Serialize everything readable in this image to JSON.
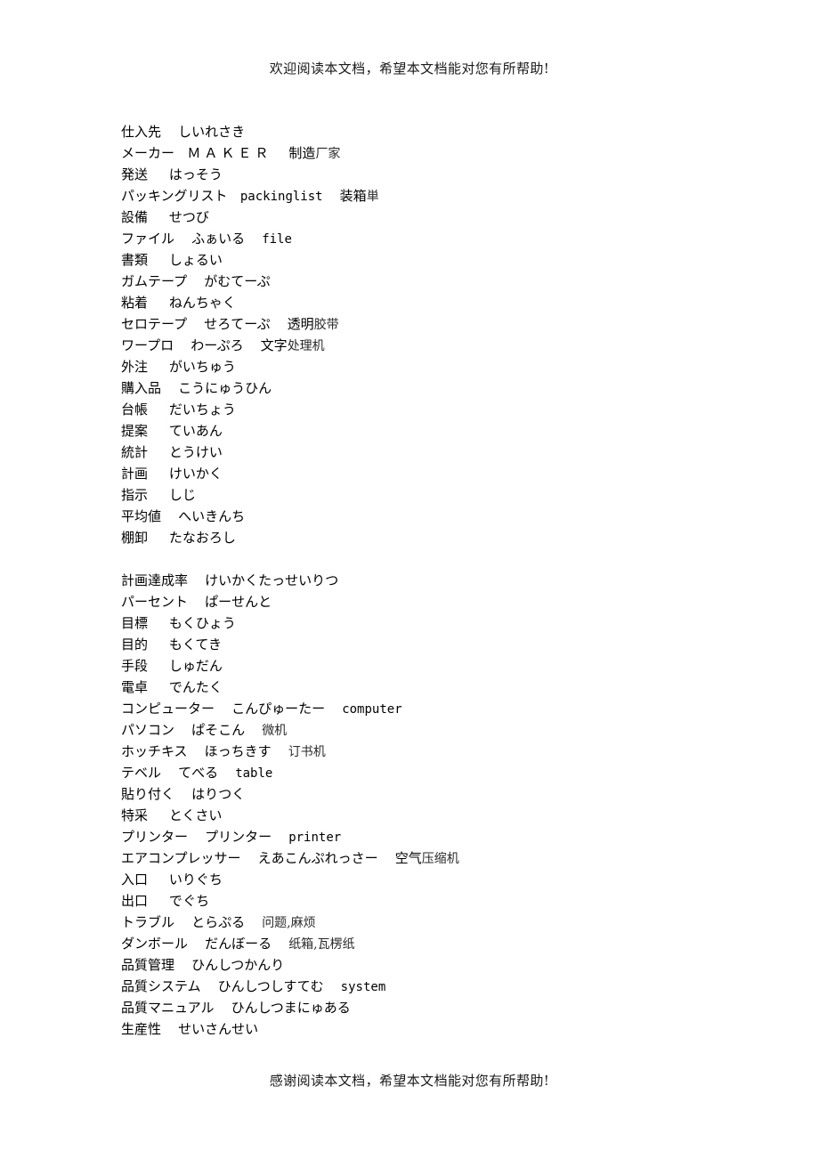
{
  "document": {
    "header_note": "欢迎阅读本文档，希望本文档能对您有所帮助!",
    "footer_note": "感谢阅读本文档，希望本文档能对您有所帮助!"
  },
  "glossary": {
    "blocks": [
      {
        "entries": [
          {
            "term": "仕入先",
            "reading": "しいれさき",
            "latin": "",
            "chinese_gothic": "",
            "chinese": ""
          },
          {
            "term": "メーカー",
            "reading": "",
            "latin": "ＭＡＫＥＲ",
            "chinese_gothic": "制造",
            "chinese": "厂家"
          },
          {
            "term": "発送",
            "reading": "はっそう",
            "latin": "",
            "chinese_gothic": "",
            "chinese": ""
          },
          {
            "term": "パッキングリスト",
            "reading": "",
            "latin": "packinglist",
            "chinese_gothic": "装箱",
            "chinese": "単"
          },
          {
            "term": "設備",
            "reading": "せつび",
            "latin": "",
            "chinese_gothic": "",
            "chinese": ""
          },
          {
            "term": "ファイル",
            "reading": "ふぁいる",
            "latin": "file",
            "chinese_gothic": "",
            "chinese": ""
          },
          {
            "term": "書類",
            "reading": "しょるい",
            "latin": "",
            "chinese_gothic": "",
            "chinese": ""
          },
          {
            "term": "ガムテープ",
            "reading": "がむてーぷ",
            "latin": "",
            "chinese_gothic": "",
            "chinese": ""
          },
          {
            "term": "粘着",
            "reading": "ねんちゃく",
            "latin": "",
            "chinese_gothic": "",
            "chinese": ""
          },
          {
            "term": "セロテープ",
            "reading": "せろてーぷ",
            "latin": "",
            "chinese_gothic": "透明",
            "chinese": "胶带"
          },
          {
            "term": "ワープロ",
            "reading": "わーぷろ",
            "latin": "",
            "chinese_gothic": "文字",
            "chinese": "处理机"
          },
          {
            "term": "外注",
            "reading": "がいちゅう",
            "latin": "",
            "chinese_gothic": "",
            "chinese": ""
          },
          {
            "term": "購入品",
            "reading": "こうにゅうひん",
            "latin": "",
            "chinese_gothic": "",
            "chinese": ""
          },
          {
            "term": "台帳",
            "reading": "だいちょう",
            "latin": "",
            "chinese_gothic": "",
            "chinese": ""
          },
          {
            "term": "提案",
            "reading": "ていあん",
            "latin": "",
            "chinese_gothic": "",
            "chinese": ""
          },
          {
            "term": "統計",
            "reading": "とうけい",
            "latin": "",
            "chinese_gothic": "",
            "chinese": ""
          },
          {
            "term": "計画",
            "reading": "けいかく",
            "latin": "",
            "chinese_gothic": "",
            "chinese": ""
          },
          {
            "term": "指示",
            "reading": "しじ",
            "latin": "",
            "chinese_gothic": "",
            "chinese": ""
          },
          {
            "term": "平均値",
            "reading": "へいきんち",
            "latin": "",
            "chinese_gothic": "",
            "chinese": ""
          },
          {
            "term": "棚卸",
            "reading": "たなおろし",
            "latin": "",
            "chinese_gothic": "",
            "chinese": ""
          }
        ]
      },
      {
        "entries": [
          {
            "term": "計画達成率",
            "reading": "けいかくたっせいりつ",
            "latin": "",
            "chinese_gothic": "",
            "chinese": ""
          },
          {
            "term": "パーセント",
            "reading": "ぱーせんと",
            "latin": "",
            "chinese_gothic": "",
            "chinese": ""
          },
          {
            "term": "目標",
            "reading": "もくひょう",
            "latin": "",
            "chinese_gothic": "",
            "chinese": ""
          },
          {
            "term": "目的",
            "reading": "もくてき",
            "latin": "",
            "chinese_gothic": "",
            "chinese": ""
          },
          {
            "term": "手段",
            "reading": "しゅだん",
            "latin": "",
            "chinese_gothic": "",
            "chinese": ""
          },
          {
            "term": "電卓",
            "reading": "でんたく",
            "latin": "",
            "chinese_gothic": "",
            "chinese": ""
          },
          {
            "term": "コンピューター",
            "reading": "こんぴゅーたー",
            "latin": "computer",
            "chinese_gothic": "",
            "chinese": ""
          },
          {
            "term": "パソコン",
            "reading": "ぱそこん",
            "latin": "",
            "chinese_gothic": "",
            "chinese": "微机"
          },
          {
            "term": "ホッチキス",
            "reading": "ほっちきす",
            "latin": "",
            "chinese_gothic": "",
            "chinese": "订书机"
          },
          {
            "term": "テベル",
            "reading": "てべる",
            "latin": "table",
            "chinese_gothic": "",
            "chinese": ""
          },
          {
            "term": "貼り付く",
            "reading": "はりつく",
            "latin": "",
            "chinese_gothic": "",
            "chinese": ""
          },
          {
            "term": "特采",
            "reading": "とくさい",
            "latin": "",
            "chinese_gothic": "",
            "chinese": ""
          },
          {
            "term": "プリンター",
            "reading": "プリンター",
            "latin": "printer",
            "chinese_gothic": "",
            "chinese": ""
          },
          {
            "term": "エアコンプレッサー",
            "reading": "えあこんぷれっさー",
            "latin": "",
            "chinese_gothic": "空气",
            "chinese": "压缩机"
          },
          {
            "term": "入口",
            "reading": "いりぐち",
            "latin": "",
            "chinese_gothic": "",
            "chinese": ""
          },
          {
            "term": "出口",
            "reading": "でぐち",
            "latin": "",
            "chinese_gothic": "",
            "chinese": ""
          },
          {
            "term": "トラブル",
            "reading": "とらぷる",
            "latin": "",
            "chinese_gothic": "",
            "chinese": "问题,麻烦"
          },
          {
            "term": "ダンボール",
            "reading": "だんぼーる",
            "latin": "",
            "chinese_gothic": "",
            "chinese": "纸箱,瓦楞纸"
          },
          {
            "term": "品質管理",
            "reading": "ひんしつかんり",
            "latin": "",
            "chinese_gothic": "",
            "chinese": ""
          },
          {
            "term": "品質システム",
            "reading": "ひんしつしすてむ",
            "latin": "system",
            "chinese_gothic": "",
            "chinese": ""
          },
          {
            "term": "品質マニュアル",
            "reading": "ひんしつまにゅある",
            "latin": "",
            "chinese_gothic": "",
            "chinese": ""
          },
          {
            "term": "生産性",
            "reading": "せいさんせい",
            "latin": "",
            "chinese_gothic": "",
            "chinese": ""
          }
        ]
      }
    ]
  }
}
